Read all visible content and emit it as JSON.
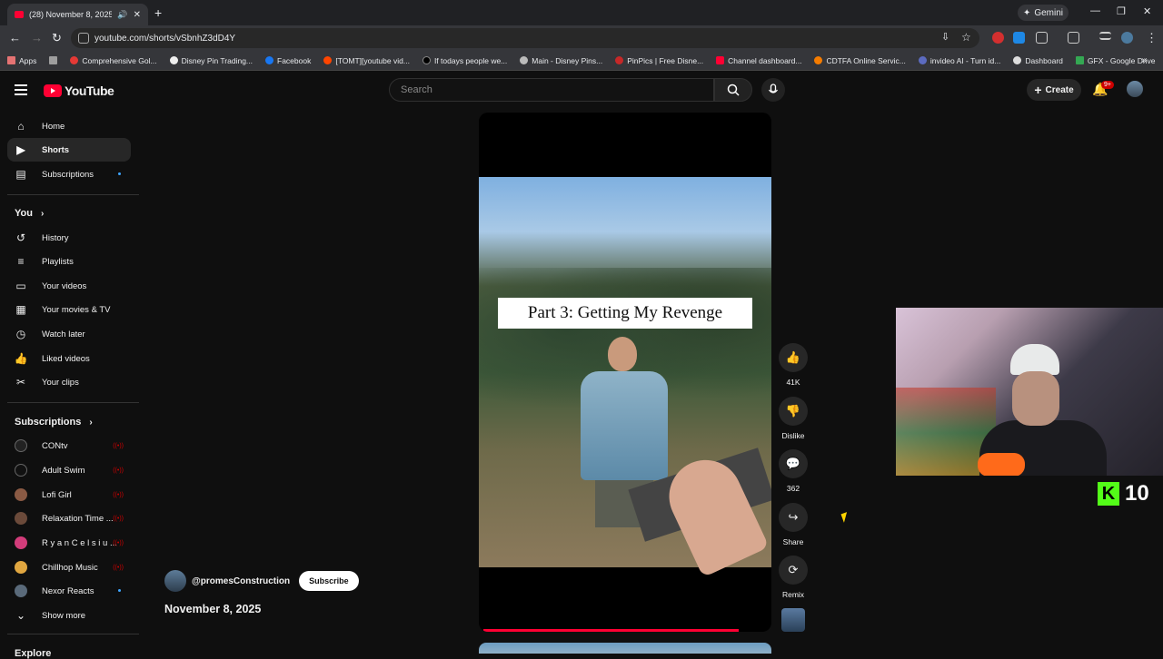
{
  "browser": {
    "tab_title": "(28) November 8, 2025 - Yo",
    "gemini_label": "Gemini",
    "url": "youtube.com/shorts/vSbnhZ3dD4Y",
    "bookmarks": [
      {
        "label": "Apps"
      },
      {
        "label": "Comprehensive Gol..."
      },
      {
        "label": "Disney Pin Trading..."
      },
      {
        "label": "Facebook"
      },
      {
        "label": "[TOMT][youtube vid..."
      },
      {
        "label": "If todays people we..."
      },
      {
        "label": "Main - Disney Pins..."
      },
      {
        "label": "PinPics | Free Disne..."
      },
      {
        "label": "Channel dashboard..."
      },
      {
        "label": "CDTFA Online Servic..."
      },
      {
        "label": "invideo AI - Turn id..."
      },
      {
        "label": "Dashboard"
      },
      {
        "label": "GFX - Google Drive"
      }
    ]
  },
  "header": {
    "logo": "YouTube",
    "search_placeholder": "Search",
    "create_label": "Create",
    "notif_badge": "9+"
  },
  "sidebar": {
    "main": [
      {
        "label": "Home",
        "icon": "home-icon"
      },
      {
        "label": "Shorts",
        "icon": "shorts-icon"
      },
      {
        "label": "Subscriptions",
        "icon": "subscriptions-icon"
      }
    ],
    "you_heading": "You",
    "you": [
      {
        "label": "History"
      },
      {
        "label": "Playlists"
      },
      {
        "label": "Your videos"
      },
      {
        "label": "Your movies & TV"
      },
      {
        "label": "Watch later"
      },
      {
        "label": "Liked videos"
      },
      {
        "label": "Your clips"
      }
    ],
    "subs_heading": "Subscriptions",
    "subs": [
      {
        "label": "CONtv",
        "color": "#222222"
      },
      {
        "label": "Adult Swim",
        "color": "#111111"
      },
      {
        "label": "Lofi Girl",
        "color": "#8a5a44"
      },
      {
        "label": "Relaxation Time ...",
        "color": "#6b4a3a"
      },
      {
        "label": "R y a n C e l s i u ...",
        "color": "#d23c7a"
      },
      {
        "label": "Chillhop Music",
        "color": "#e0a640"
      },
      {
        "label": "Nexor Reacts",
        "color": "#5a6a7a"
      }
    ],
    "show_more": "Show more",
    "explore": "Explore"
  },
  "video": {
    "caption": "Part 3: Getting My Revenge",
    "progress": 0.9
  },
  "actions": {
    "likes": "41K",
    "dislike": "Dislike",
    "comments": "362",
    "share": "Share",
    "remix": "Remix"
  },
  "channel": {
    "handle": "@promesConstruction",
    "subscribe": "Subscribe",
    "date": "November 8, 2025"
  },
  "overlay": {
    "kick_letter": "K",
    "kick_count": "10"
  },
  "colors": {
    "accent": "#ff0033",
    "kick": "#53fc18"
  }
}
